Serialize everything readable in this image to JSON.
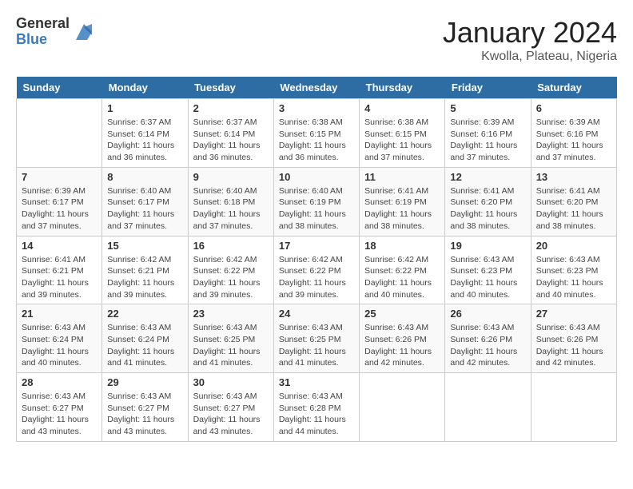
{
  "header": {
    "logo_general": "General",
    "logo_blue": "Blue",
    "title": "January 2024",
    "location": "Kwolla, Plateau, Nigeria"
  },
  "columns": [
    "Sunday",
    "Monday",
    "Tuesday",
    "Wednesday",
    "Thursday",
    "Friday",
    "Saturday"
  ],
  "weeks": [
    [
      {
        "day": "",
        "sunrise": "",
        "sunset": "",
        "daylight": ""
      },
      {
        "day": "1",
        "sunrise": "Sunrise: 6:37 AM",
        "sunset": "Sunset: 6:14 PM",
        "daylight": "Daylight: 11 hours and 36 minutes."
      },
      {
        "day": "2",
        "sunrise": "Sunrise: 6:37 AM",
        "sunset": "Sunset: 6:14 PM",
        "daylight": "Daylight: 11 hours and 36 minutes."
      },
      {
        "day": "3",
        "sunrise": "Sunrise: 6:38 AM",
        "sunset": "Sunset: 6:15 PM",
        "daylight": "Daylight: 11 hours and 36 minutes."
      },
      {
        "day": "4",
        "sunrise": "Sunrise: 6:38 AM",
        "sunset": "Sunset: 6:15 PM",
        "daylight": "Daylight: 11 hours and 37 minutes."
      },
      {
        "day": "5",
        "sunrise": "Sunrise: 6:39 AM",
        "sunset": "Sunset: 6:16 PM",
        "daylight": "Daylight: 11 hours and 37 minutes."
      },
      {
        "day": "6",
        "sunrise": "Sunrise: 6:39 AM",
        "sunset": "Sunset: 6:16 PM",
        "daylight": "Daylight: 11 hours and 37 minutes."
      }
    ],
    [
      {
        "day": "7",
        "sunrise": "Sunrise: 6:39 AM",
        "sunset": "Sunset: 6:17 PM",
        "daylight": "Daylight: 11 hours and 37 minutes."
      },
      {
        "day": "8",
        "sunrise": "Sunrise: 6:40 AM",
        "sunset": "Sunset: 6:17 PM",
        "daylight": "Daylight: 11 hours and 37 minutes."
      },
      {
        "day": "9",
        "sunrise": "Sunrise: 6:40 AM",
        "sunset": "Sunset: 6:18 PM",
        "daylight": "Daylight: 11 hours and 37 minutes."
      },
      {
        "day": "10",
        "sunrise": "Sunrise: 6:40 AM",
        "sunset": "Sunset: 6:19 PM",
        "daylight": "Daylight: 11 hours and 38 minutes."
      },
      {
        "day": "11",
        "sunrise": "Sunrise: 6:41 AM",
        "sunset": "Sunset: 6:19 PM",
        "daylight": "Daylight: 11 hours and 38 minutes."
      },
      {
        "day": "12",
        "sunrise": "Sunrise: 6:41 AM",
        "sunset": "Sunset: 6:20 PM",
        "daylight": "Daylight: 11 hours and 38 minutes."
      },
      {
        "day": "13",
        "sunrise": "Sunrise: 6:41 AM",
        "sunset": "Sunset: 6:20 PM",
        "daylight": "Daylight: 11 hours and 38 minutes."
      }
    ],
    [
      {
        "day": "14",
        "sunrise": "Sunrise: 6:41 AM",
        "sunset": "Sunset: 6:21 PM",
        "daylight": "Daylight: 11 hours and 39 minutes."
      },
      {
        "day": "15",
        "sunrise": "Sunrise: 6:42 AM",
        "sunset": "Sunset: 6:21 PM",
        "daylight": "Daylight: 11 hours and 39 minutes."
      },
      {
        "day": "16",
        "sunrise": "Sunrise: 6:42 AM",
        "sunset": "Sunset: 6:22 PM",
        "daylight": "Daylight: 11 hours and 39 minutes."
      },
      {
        "day": "17",
        "sunrise": "Sunrise: 6:42 AM",
        "sunset": "Sunset: 6:22 PM",
        "daylight": "Daylight: 11 hours and 39 minutes."
      },
      {
        "day": "18",
        "sunrise": "Sunrise: 6:42 AM",
        "sunset": "Sunset: 6:22 PM",
        "daylight": "Daylight: 11 hours and 40 minutes."
      },
      {
        "day": "19",
        "sunrise": "Sunrise: 6:43 AM",
        "sunset": "Sunset: 6:23 PM",
        "daylight": "Daylight: 11 hours and 40 minutes."
      },
      {
        "day": "20",
        "sunrise": "Sunrise: 6:43 AM",
        "sunset": "Sunset: 6:23 PM",
        "daylight": "Daylight: 11 hours and 40 minutes."
      }
    ],
    [
      {
        "day": "21",
        "sunrise": "Sunrise: 6:43 AM",
        "sunset": "Sunset: 6:24 PM",
        "daylight": "Daylight: 11 hours and 40 minutes."
      },
      {
        "day": "22",
        "sunrise": "Sunrise: 6:43 AM",
        "sunset": "Sunset: 6:24 PM",
        "daylight": "Daylight: 11 hours and 41 minutes."
      },
      {
        "day": "23",
        "sunrise": "Sunrise: 6:43 AM",
        "sunset": "Sunset: 6:25 PM",
        "daylight": "Daylight: 11 hours and 41 minutes."
      },
      {
        "day": "24",
        "sunrise": "Sunrise: 6:43 AM",
        "sunset": "Sunset: 6:25 PM",
        "daylight": "Daylight: 11 hours and 41 minutes."
      },
      {
        "day": "25",
        "sunrise": "Sunrise: 6:43 AM",
        "sunset": "Sunset: 6:26 PM",
        "daylight": "Daylight: 11 hours and 42 minutes."
      },
      {
        "day": "26",
        "sunrise": "Sunrise: 6:43 AM",
        "sunset": "Sunset: 6:26 PM",
        "daylight": "Daylight: 11 hours and 42 minutes."
      },
      {
        "day": "27",
        "sunrise": "Sunrise: 6:43 AM",
        "sunset": "Sunset: 6:26 PM",
        "daylight": "Daylight: 11 hours and 42 minutes."
      }
    ],
    [
      {
        "day": "28",
        "sunrise": "Sunrise: 6:43 AM",
        "sunset": "Sunset: 6:27 PM",
        "daylight": "Daylight: 11 hours and 43 minutes."
      },
      {
        "day": "29",
        "sunrise": "Sunrise: 6:43 AM",
        "sunset": "Sunset: 6:27 PM",
        "daylight": "Daylight: 11 hours and 43 minutes."
      },
      {
        "day": "30",
        "sunrise": "Sunrise: 6:43 AM",
        "sunset": "Sunset: 6:27 PM",
        "daylight": "Daylight: 11 hours and 43 minutes."
      },
      {
        "day": "31",
        "sunrise": "Sunrise: 6:43 AM",
        "sunset": "Sunset: 6:28 PM",
        "daylight": "Daylight: 11 hours and 44 minutes."
      },
      {
        "day": "",
        "sunrise": "",
        "sunset": "",
        "daylight": ""
      },
      {
        "day": "",
        "sunrise": "",
        "sunset": "",
        "daylight": ""
      },
      {
        "day": "",
        "sunrise": "",
        "sunset": "",
        "daylight": ""
      }
    ]
  ]
}
